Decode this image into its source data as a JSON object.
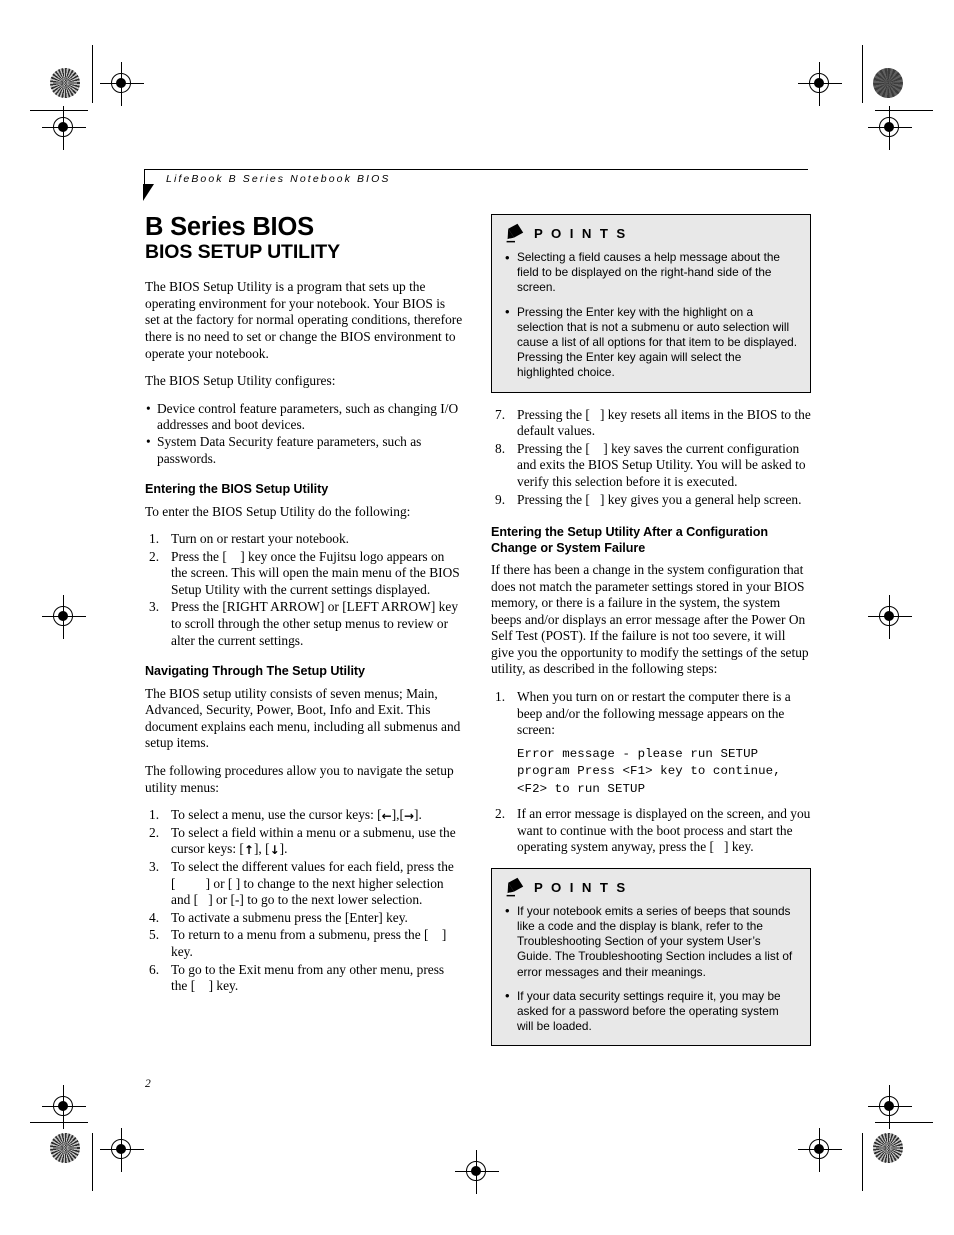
{
  "page": {
    "running_header": "LifeBook B Series Notebook BIOS",
    "page_number": "2",
    "title": "B Series BIOS",
    "subtitle": "BIOS SETUP UTILITY"
  },
  "left_column": {
    "intro": "The BIOS Setup Utility is a program that sets up the operating environment for your notebook. Your BIOS is set at the factory for normal operating conditions, therefore there is no need to set or change the BIOS environment to operate your notebook.",
    "configures_lead": "The BIOS Setup Utility configures:",
    "configures_bullets": [
      "Device control feature parameters, such as changing I/O addresses and boot devices.",
      "System Data Security feature parameters, such as passwords."
    ],
    "entering_heading": "Entering the BIOS Setup Utility",
    "entering_lead": "To enter the BIOS Setup Utility do the following:",
    "entering_steps": [
      {
        "num": "1.",
        "pre": "Turn on or restart your notebook.",
        "key": "",
        "post": ""
      },
      {
        "num": "2.",
        "pre": "Press the [",
        "key": "    ",
        "post": "] key once the Fujitsu logo appears on the screen. This will open the main menu of the BIOS Setup Utility with the current settings displayed."
      },
      {
        "num": "3.",
        "pre": "Press the [RIGHT ARROW] or [LEFT ARROW] key to scroll through the other setup menus to review or alter the current settings.",
        "key": "",
        "post": ""
      }
    ],
    "navigating_heading": "Navigating Through The Setup Utility",
    "navigating_p1": "The BIOS setup utility consists of seven menus; Main, Advanced, Security, Power, Boot, Info and Exit. This document explains each menu, including all submenus and setup items.",
    "navigating_p2": "The following procedures allow you to navigate the setup utility menus:",
    "nav_step_1_a": "To select a menu, use the cursor keys: [",
    "nav_step_1_arrow_left": "←",
    "nav_step_1_b": "],[",
    "nav_step_1_arrow_right": "→",
    "nav_step_1_c": "].",
    "nav_step_2_a": "To select a field within a menu or a submenu, use the cursor keys: [",
    "nav_step_2_arrow_up": "↑",
    "nav_step_2_b": "], [",
    "nav_step_2_arrow_down": "↓",
    "nav_step_2_c": "].",
    "nav_step_3_a": "To select the different values for each field, press the [",
    "nav_step_3_b": "] or [",
    "nav_step_3_c": "] to change to the next higher selection and [",
    "nav_step_3_d": "] or [-] to go to the next lower selection.",
    "nav_step_4": "To activate a submenu press the [Enter] key.",
    "nav_step_5_a": "To return to a menu from a submenu, press the [",
    "nav_step_5_b": "] key.",
    "nav_step_6_a": "To go to the Exit menu from any other menu, press the [",
    "nav_step_6_b": "] key.",
    "step_numbers": [
      "1.",
      "2.",
      "3.",
      "4.",
      "5.",
      "6."
    ]
  },
  "right_column": {
    "points_box_1": {
      "title": "P O I N T S",
      "icon": "pencil-icon",
      "bullets": [
        "Selecting a field causes a help message about the field to be displayed on the right-hand side of the screen.",
        "Pressing the Enter key with the highlight on a selection that is not a submenu or auto selection will cause a list of all options for that item to be displayed. Pressing the Enter key again will select the highlighted choice."
      ]
    },
    "steps_7_9": [
      {
        "num": "7.",
        "a": "Pressing the [",
        "b": "] key resets all items in the BIOS to the default values."
      },
      {
        "num": "8.",
        "a": "Pressing the [",
        "b": "] key saves the current configuration and exits the BIOS Setup Utility. You will be asked to verify this selection before it is executed."
      },
      {
        "num": "9.",
        "a": "Pressing the [",
        "b": "] key gives you a general help screen."
      }
    ],
    "config_heading": "Entering the Setup Utility After a Configuration Change or System Failure",
    "config_body": "If there has been a change in the system configuration that does not match the parameter settings stored in your BIOS memory, or there is a failure in the system, the system beeps and/or displays an error message after the Power On Self Test (POST). If the failure is not too severe, it will give you the opportunity to modify the settings of the setup utility, as described in the following steps:",
    "config_step_1_num": "1.",
    "config_step_1": "When you turn on or restart the computer there is a beep and/or the following message appears on the screen:",
    "screen_message": "Error message - please run SETUP\nprogram Press <F1> key to continue,\n<F2> to run SETUP",
    "config_step_2_num": "2.",
    "config_step_2_a": "If an error message is displayed on the screen, and you want to continue with the boot process and start the operating system anyway, press the [",
    "config_step_2_b": "] key.",
    "points_box_2": {
      "title": "P O I N T S",
      "icon": "pencil-icon",
      "bullets": [
        "If your notebook emits a series of beeps that sounds like a code and the display is blank, refer to the Troubleshooting Section of your system User’s Guide. The Troubleshooting Section includes a list of error messages and their meanings.",
        "If your data security settings require it, you may be asked for a password before the operating system will be loaded."
      ]
    }
  },
  "print_marks": {
    "registration_mark": "registration-target-icon",
    "density_patch": "density-patch-icon",
    "trim_line": "trim-line"
  },
  "colors": {
    "ink": "#000000",
    "paper": "#ffffff",
    "callout_fill": "#e8e8e8",
    "callout_border": "#000000"
  }
}
